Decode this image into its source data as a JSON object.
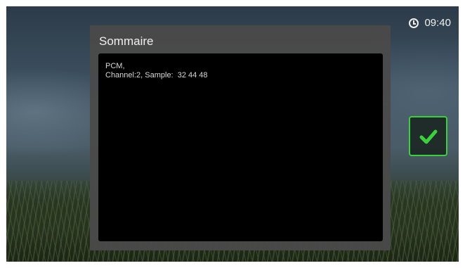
{
  "status": {
    "clock_icon": "clock-icon",
    "time": "09:40"
  },
  "dialog": {
    "title": "Sommaire",
    "content_lines": [
      "PCM,",
      "Channel:2, Sample:  32 44 48"
    ]
  },
  "confirm_button": {
    "icon": "check-icon",
    "accent_color": "#3ad23a"
  }
}
